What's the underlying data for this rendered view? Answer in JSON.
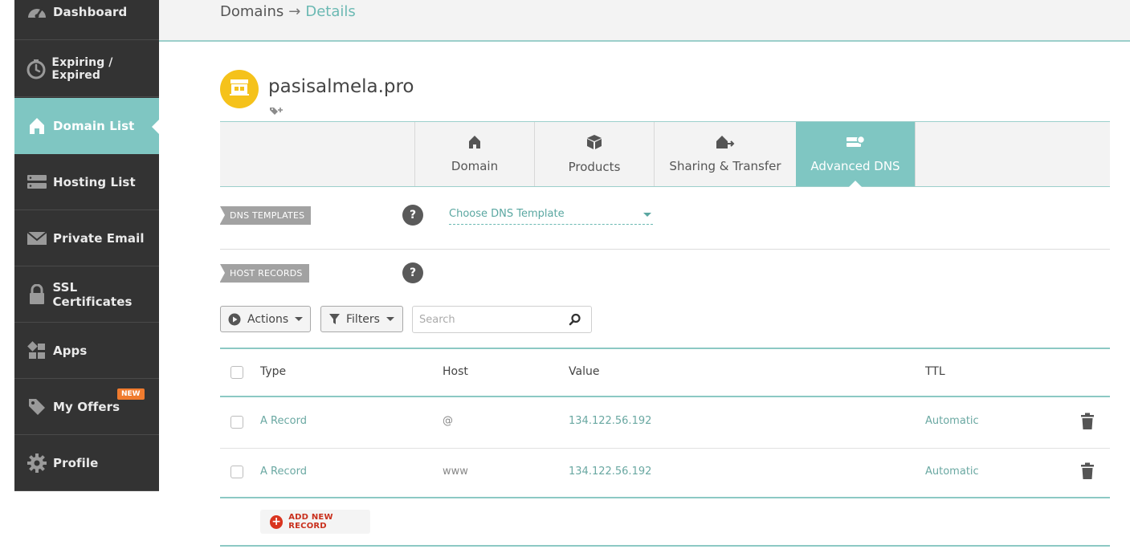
{
  "sidebar": {
    "items": [
      {
        "label": "Dashboard",
        "icon": "gauge-icon"
      },
      {
        "label": "Expiring / Expired",
        "icon": "timer-icon"
      },
      {
        "label": "Domain List",
        "icon": "home-icon",
        "active": true
      },
      {
        "label": "Hosting List",
        "icon": "server-icon"
      },
      {
        "label": "Private Email",
        "icon": "envelope-icon"
      },
      {
        "label": "SSL Certificates",
        "icon": "lock-icon"
      },
      {
        "label": "Apps",
        "icon": "apps-icon"
      },
      {
        "label": "My Offers",
        "icon": "tag-icon",
        "badge": "NEW"
      },
      {
        "label": "Profile",
        "icon": "gear-icon"
      }
    ]
  },
  "breadcrumb": {
    "root": "Domains",
    "separator": "→",
    "current": "Details"
  },
  "domain": {
    "name": "pasisalmela.pro"
  },
  "tabs": [
    {
      "label": "Domain",
      "icon": "home-icon"
    },
    {
      "label": "Products",
      "icon": "box-icon"
    },
    {
      "label": "Sharing & Transfer",
      "icon": "house-arrow-icon"
    },
    {
      "label": "Advanced DNS",
      "icon": "dns-icon",
      "active": true
    }
  ],
  "dns_templates": {
    "label": "DNS TEMPLATES",
    "select_value": "Choose DNS Template",
    "help": "?"
  },
  "host_records": {
    "label": "HOST RECORDS",
    "help": "?"
  },
  "toolbar": {
    "actions_label": "Actions",
    "filters_label": "Filters",
    "search_placeholder": "Search"
  },
  "table": {
    "columns": [
      "Type",
      "Host",
      "Value",
      "TTL"
    ],
    "rows": [
      {
        "type": "A Record",
        "host": "@",
        "value": "134.122.56.192",
        "ttl": "Automatic"
      },
      {
        "type": "A Record",
        "host": "www",
        "value": "134.122.56.192",
        "ttl": "Automatic"
      }
    ]
  },
  "add_record": {
    "label": "ADD NEW RECORD"
  },
  "colors": {
    "accent": "#7fc6c2",
    "sidebar": "#333333",
    "logo": "#f5c21b",
    "danger": "#d9341f",
    "badge": "#f07b2e"
  }
}
